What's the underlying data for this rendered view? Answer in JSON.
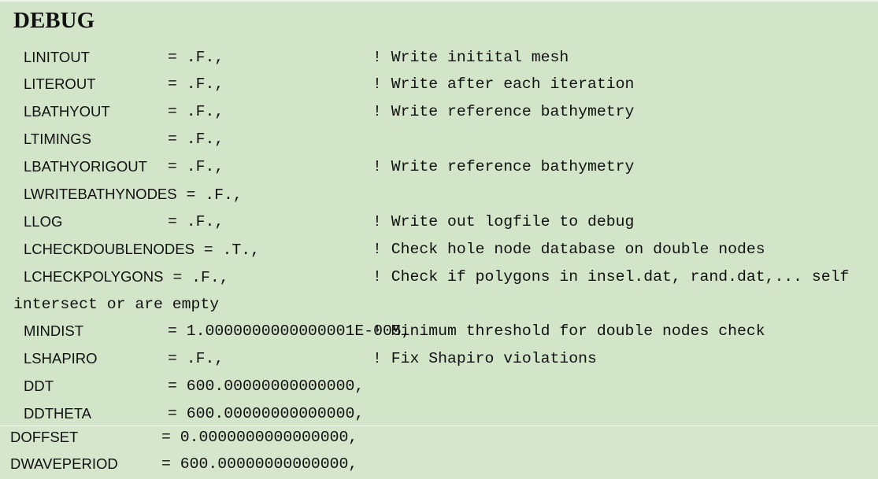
{
  "title": "DEBUG",
  "lines": [
    {
      "name": "LINITOUT",
      "assign": "= .F.,",
      "comment": "! Write initital mesh"
    },
    {
      "name": "LITEROUT",
      "assign": "= .F.,",
      "comment": "! Write after each iteration"
    },
    {
      "name": "LBATHYOUT",
      "assign": "= .F.,",
      "comment": "! Write reference bathymetry"
    },
    {
      "name": "LTIMINGS",
      "assign": "= .F.,",
      "comment": ""
    },
    {
      "name": "LBATHYORIGOUT",
      "assign": "= .F.,",
      "comment": "! Write reference bathymetry"
    },
    {
      "name": "LWRITEBATHYNODES",
      "assign": "= .F.,",
      "comment": ""
    },
    {
      "name": "LLOG",
      "assign": "= .F.,",
      "comment": "! Write out logfile to debug"
    },
    {
      "name": "LCHECKDOUBLENODES",
      "assign": "= .T.,",
      "comment": "! Check hole node database on double nodes"
    },
    {
      "name": "LCHECKPOLYGONS",
      "assign": "= .F.,",
      "comment": "! Check if polygons in insel.dat, rand.dat,... self"
    },
    {
      "name": "",
      "assign": "",
      "comment": "intersect or are empty"
    },
    {
      "name": "MINDIST",
      "assign": "= 1.0000000000000001E-005,",
      "comment": "! Minimum threshold for double nodes check"
    },
    {
      "name": "LSHAPIRO",
      "assign": "= .F.,",
      "comment": "! Fix Shapiro violations"
    },
    {
      "name": "DDT",
      "assign": "= 600.00000000000000,",
      "comment": ""
    },
    {
      "name": "DDTHETA",
      "assign": "= 600.00000000000000,",
      "comment": ""
    }
  ],
  "lower_lines": [
    {
      "name": "DOFFSET",
      "assign": "= 0.0000000000000000,"
    },
    {
      "name": "DWAVEPERIOD",
      "assign": "= 600.00000000000000,"
    }
  ]
}
